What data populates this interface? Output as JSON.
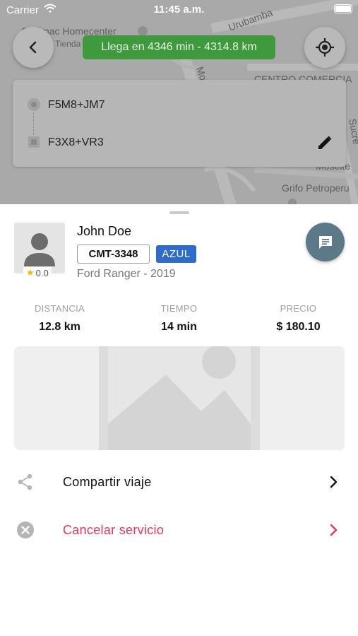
{
  "status_bar": {
    "carrier": "Carrier",
    "time": "11:45 a.m."
  },
  "map": {
    "eta_label": "Llega en 4346 min - 4314.8 km",
    "labels": {
      "store": "Sodimac Homecenter",
      "store_sub": "Tienda",
      "urubamba": "Urubamba",
      "street": "Mo",
      "centro": "CENTRO COMERCIA",
      "sucre": "Sucre",
      "mosel": "Moselte",
      "grifo": "Grifo Petroperu"
    }
  },
  "route": {
    "origin": "F5M8+JM7",
    "destination": "F3X8+VR3"
  },
  "driver": {
    "name": "John Doe",
    "rating": "0.0",
    "plate": "CMT-3348",
    "color_label": "AZUL",
    "vehicle": "Ford Ranger - 2019"
  },
  "stats": {
    "distance": {
      "label": "DISTANCIA",
      "value": "12.8 km"
    },
    "time": {
      "label": "TIEMPO",
      "value": "14 min"
    },
    "price": {
      "label": "PRECIO",
      "value": "$ 180.10"
    }
  },
  "actions": {
    "share": "Compartir viaje",
    "cancel": "Cancelar servicio"
  },
  "colors": {
    "eta_green": "#3f9a3e",
    "badge_blue": "#2f6cc9",
    "chat_button": "#5b7987",
    "cancel_red": "#e8355c"
  },
  "icons": {
    "back": "arrow-left-icon",
    "locate": "crosshair-gps-icon",
    "edit": "pencil-icon",
    "chat": "chat-bubble-icon",
    "share": "share-icon",
    "cancel": "close-circle-icon",
    "chevron": "chevron-right-icon",
    "star": "star-icon",
    "avatar": "person-silhouette-icon",
    "photo": "image-placeholder-icon"
  }
}
